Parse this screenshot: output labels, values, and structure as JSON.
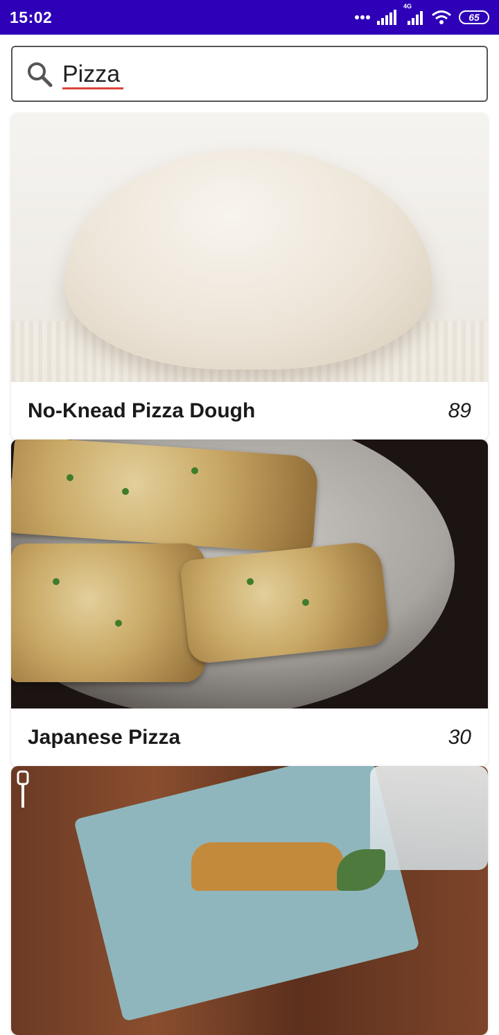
{
  "status_bar": {
    "time": "15:02",
    "network_label": "4G",
    "battery": "65"
  },
  "search": {
    "value": "Pizza"
  },
  "results": [
    {
      "title": "No-Knead Pizza Dough",
      "count": "89",
      "image": "pizza-dough"
    },
    {
      "title": "Japanese Pizza",
      "count": "30",
      "image": "japanese-pizza"
    },
    {
      "title": "",
      "count": "",
      "image": "third-recipe-image"
    }
  ],
  "colors": {
    "status_bar": "#2e00b8",
    "spell_underline": "#d9443b"
  }
}
